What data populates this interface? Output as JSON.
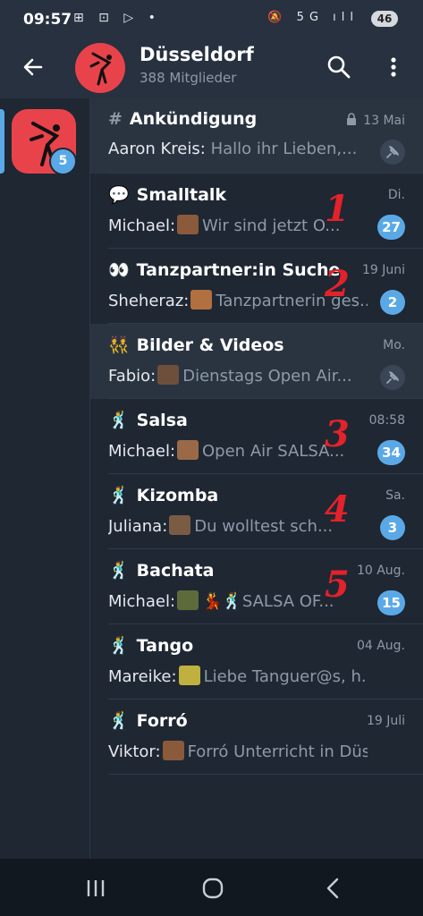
{
  "status": {
    "time": "09:57",
    "left_icons": "⊞ ⊡ ▷ •",
    "right_icons": "🔕 5G ıll",
    "battery": "46"
  },
  "header": {
    "title": "Düsseldorf",
    "subtitle": "388 Mitglieder"
  },
  "sidebar": {
    "badge": "5"
  },
  "topics": [
    {
      "icon": "#",
      "title": "Ankündigung",
      "date": "13 Mai",
      "locked": true,
      "sender": "Aaron Kreis:",
      "message": "Hallo ihr Lieben,...",
      "pinned": true
    },
    {
      "icon": "💬",
      "title": "Smalltalk",
      "date": "Di.",
      "sender": "Michael:",
      "message": "Wir sind jetzt O...",
      "badge": "27",
      "number": "1"
    },
    {
      "icon": "👀",
      "title": "Tanzpartner:in Suche",
      "date": "19 Juni",
      "sender": "Sheheraz:",
      "message": "Tanzpartnerin ges...",
      "badge": "2",
      "number": "2"
    },
    {
      "icon": "👯",
      "title": "Bilder & Videos",
      "date": "Mo.",
      "sender": "Fabio:",
      "message": "Dienstags Open Air...",
      "pinned": true
    },
    {
      "icon": "🕺",
      "title": "Salsa",
      "date": "08:58",
      "sender": "Michael:",
      "message": "Open Air SALSA...",
      "badge": "34",
      "number": "3"
    },
    {
      "icon": "🕺",
      "title": "Kizomba",
      "date": "Sa.",
      "sender": "Juliana:",
      "message": "Du wolltest sch...",
      "badge": "3",
      "number": "4"
    },
    {
      "icon": "🕺",
      "title": "Bachata",
      "date": "10 Aug.",
      "sender": "Michael:",
      "message": "💃🕺SALSA OF...",
      "badge": "15",
      "number": "5"
    },
    {
      "icon": "🕺",
      "title": "Tango",
      "date": "04 Aug.",
      "sender": "Mareike:",
      "message": "Liebe Tanguer@s,   h..."
    },
    {
      "icon": "🕺",
      "title": "Forró",
      "date": "19 Juli",
      "sender": "Viktor:",
      "message": "Forró Unterricht in Düs..."
    }
  ],
  "colors": {
    "accent": "#5aa9e6",
    "avatar": "#e8434b",
    "bg": "#1f2733",
    "annotation": "#e3222a"
  }
}
